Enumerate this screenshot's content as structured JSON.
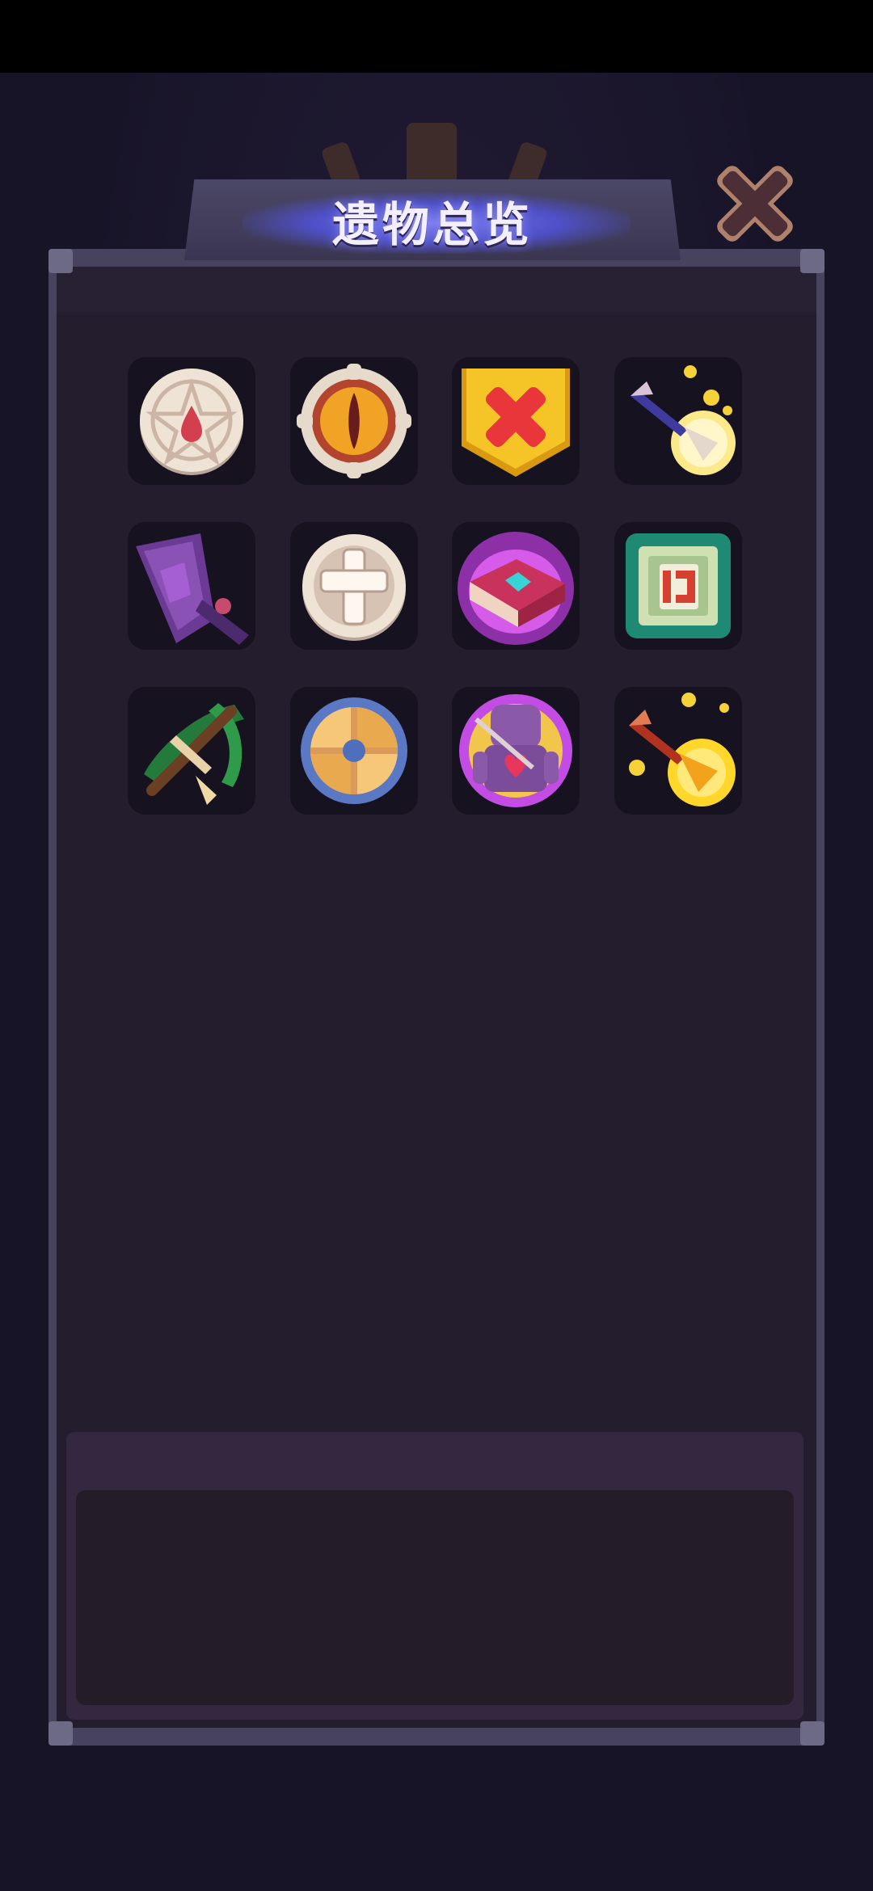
{
  "screen": {
    "title": "遗物总览",
    "close_icon": "close-x-icon"
  },
  "relics": [
    {
      "icon": "pentagram-blood-seal-icon"
    },
    {
      "icon": "dragon-eye-medallion-icon"
    },
    {
      "icon": "red-cross-yellow-shield-icon"
    },
    {
      "icon": "glowing-arrow-icon"
    },
    {
      "icon": "crystal-purple-axe-icon"
    },
    {
      "icon": "cross-coin-icon"
    },
    {
      "icon": "burning-spellbook-icon"
    },
    {
      "icon": "circuit-chip-icon"
    },
    {
      "icon": "jade-crossbow-icon"
    },
    {
      "icon": "round-wooden-shield-icon"
    },
    {
      "icon": "cursed-voodoo-doll-icon"
    },
    {
      "icon": "flaming-golden-arrow-icon"
    }
  ],
  "description": {
    "text": ""
  },
  "colors": {
    "background": "#181428",
    "panel": "#231d2e",
    "banner_glow": "#6c6ee8",
    "close_button": "#4a2e34"
  }
}
